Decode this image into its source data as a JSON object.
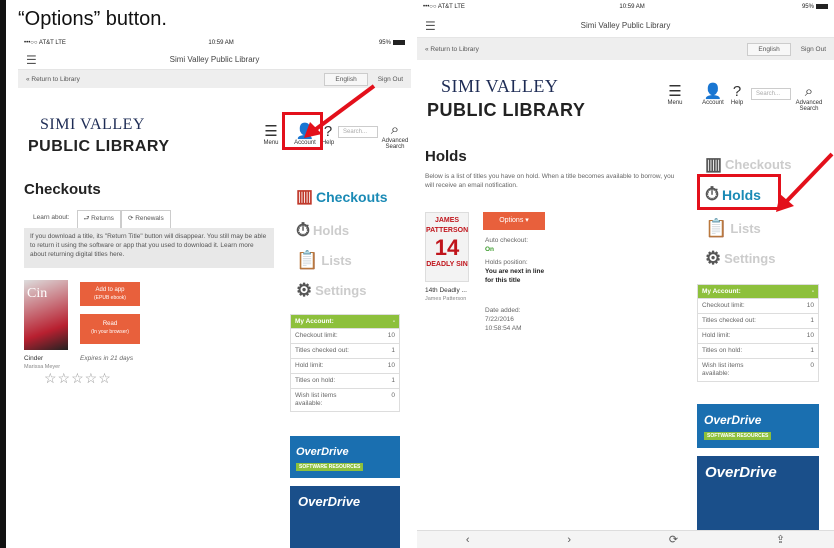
{
  "caption": "“Options” button.",
  "status": {
    "carrier": "•••○○ AT&T  LTE",
    "time": "10:59 AM",
    "battery": "  95%"
  },
  "header": {
    "title": "Simi Valley Public Library"
  },
  "subbar": {
    "return": "« Return to Library",
    "language": "English",
    "signout": "Sign Out"
  },
  "logo": {
    "line1": "SIMI VALLEY",
    "line2": "PUBLIC LIBRARY"
  },
  "nav": {
    "menu": "Menu",
    "account": "Account",
    "help": "Help",
    "search_placeholder": "Search...",
    "advanced": "Advanced Search"
  },
  "left": {
    "heading": "Checkouts",
    "learn": "Learn about:",
    "tabs": [
      "Returns",
      "Renewals"
    ],
    "info": "If you download a title, its \"Return Title\" button will disappear. You still may be able to return it using the software or app that you used to download it. Learn more about returning digital titles here.",
    "book_title": "Cinder",
    "book_author": "Marissa Meyer",
    "expires": "Expires in 21 days",
    "add_btn": "Add to app",
    "add_sub": "(EPUB ebook)",
    "read_btn": "Read",
    "read_sub": "(In your browser)",
    "cover_text": "Cin"
  },
  "right": {
    "heading": "Holds",
    "intro": "Below is a list of titles you have on hold. When a title becomes available to borrow, you will receive an email notification.",
    "options_btn": "Options",
    "auto_label": "Auto checkout:",
    "auto_value": "On",
    "pos_label": "Holds position:",
    "pos_value": "You are next in line for this title",
    "date_label": "Date added:",
    "date_value": "7/22/2016",
    "time_value": "10:58:54 AM",
    "book_title": "14th Deadly ...",
    "book_author": "James Patterson",
    "cover_top": "JAMES PATTERSON",
    "cover_mid": "14",
    "cover_bot": "DEADLY SIN"
  },
  "sidebar": [
    "Checkouts",
    "Holds",
    "Lists",
    "Settings"
  ],
  "account": {
    "title": "My Account:",
    "rows": [
      {
        "label": "Checkout limit:",
        "value": "10"
      },
      {
        "label": "Titles checked out:",
        "value": "1"
      },
      {
        "label": "Hold limit:",
        "value": "10"
      },
      {
        "label": "Titles on hold:",
        "value": "1"
      },
      {
        "label": "Wish list items available:",
        "value": "0"
      }
    ]
  },
  "overdrive": {
    "brand": "OverDrive",
    "sub": "SOFTWARE RESOURCES"
  },
  "colors": {
    "highlight": "#e3101b",
    "accent_green": "#8dc03c",
    "button_orange": "#e8603c",
    "active_link": "#1a8ab5"
  }
}
